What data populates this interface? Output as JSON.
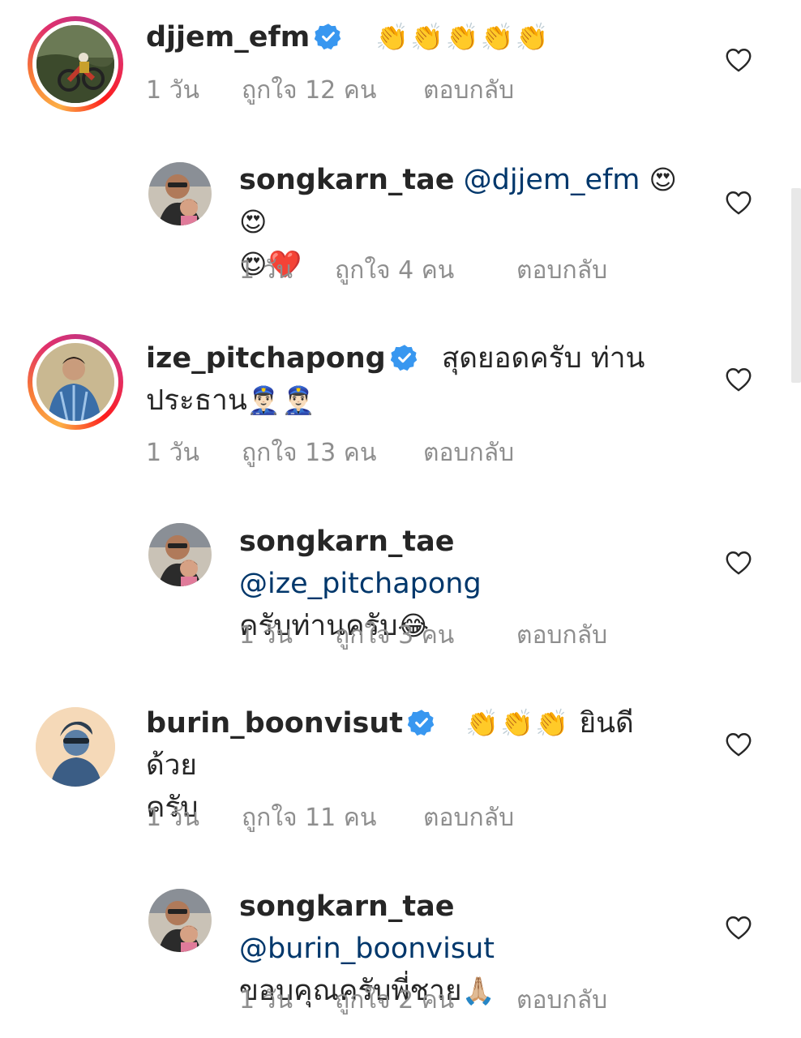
{
  "comments": [
    {
      "username": "djjem_efm",
      "verified": true,
      "mention": "",
      "text": "",
      "emoji": "👏👏👏👏👏",
      "time": "1 วัน",
      "likes": "ถูกใจ 12 คน",
      "reply": "ตอบกลับ"
    },
    {
      "username": "songkarn_tae",
      "verified": false,
      "mention": "@djjem_efm",
      "text": "",
      "emoji": "😍😍",
      "emoji2": "😍❤️",
      "time": "1 วัน",
      "likes": "ถูกใจ 4 คน",
      "reply": "ตอบกลับ"
    },
    {
      "username": "ize_pitchapong",
      "verified": true,
      "mention": "",
      "text": "สุดยอดครับ ท่าน",
      "text2": "ประธาน",
      "emoji": "👮🏻‍♂️👮🏻‍♂️",
      "time": "1 วัน",
      "likes": "ถูกใจ 13 คน",
      "reply": "ตอบกลับ"
    },
    {
      "username": "songkarn_tae",
      "verified": false,
      "mention": "@ize_pitchapong",
      "text": "ครับท่านครับ",
      "emoji": "😂",
      "time": "1 วัน",
      "likes": "ถูกใจ 3 คน",
      "reply": "ตอบกลับ"
    },
    {
      "username": "burin_boonvisut",
      "verified": true,
      "mention": "",
      "emoji": "👏👏👏",
      "text": "ยินดีด้วย",
      "text2": "ครับ",
      "time": "1 วัน",
      "likes": "ถูกใจ 11 คน",
      "reply": "ตอบกลับ"
    },
    {
      "username": "songkarn_tae",
      "verified": false,
      "mention": "@burin_boonvisut",
      "text": "ขอบคุณครับพี่ชาย",
      "emoji": "🙏🏼",
      "time": "1 วัน",
      "likes": "ถูกใจ 2 คน",
      "reply": "ตอบกลับ"
    }
  ],
  "icons": {
    "like": "heart-outline-icon",
    "verified": "verified-badge-icon"
  },
  "colors": {
    "verified": "#3897f0",
    "mention": "#00376b",
    "meta": "#8e8e8e",
    "text": "#262626"
  }
}
